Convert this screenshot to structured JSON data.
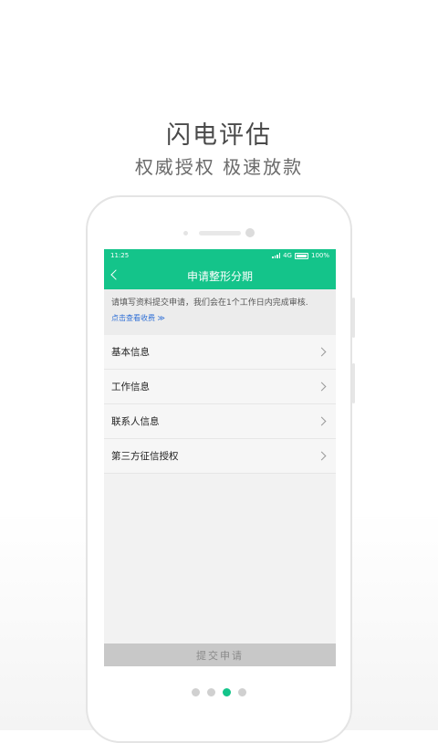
{
  "promo": {
    "title": "闪电评估",
    "subtitle": "权威授权  极速放款"
  },
  "status_bar": {
    "time": "11:25",
    "network": "4G",
    "battery": "100%"
  },
  "nav": {
    "back_icon": "chevron-left-icon",
    "title": "申请整形分期"
  },
  "notice": {
    "text": "请填写资料提交申请，我们会在1个工作日内完成审核.",
    "link": "点击查看收费 ≫"
  },
  "list": {
    "items": [
      {
        "label": "基本信息"
      },
      {
        "label": "工作信息"
      },
      {
        "label": "联系人信息"
      },
      {
        "label": "第三方征信授权"
      }
    ]
  },
  "submit": {
    "label": "提交申请"
  },
  "pager": {
    "count": 4,
    "active_index": 2
  },
  "colors": {
    "accent": "#14c48a",
    "link": "#2f6fd6",
    "submit_bg": "#c8c8c8"
  }
}
